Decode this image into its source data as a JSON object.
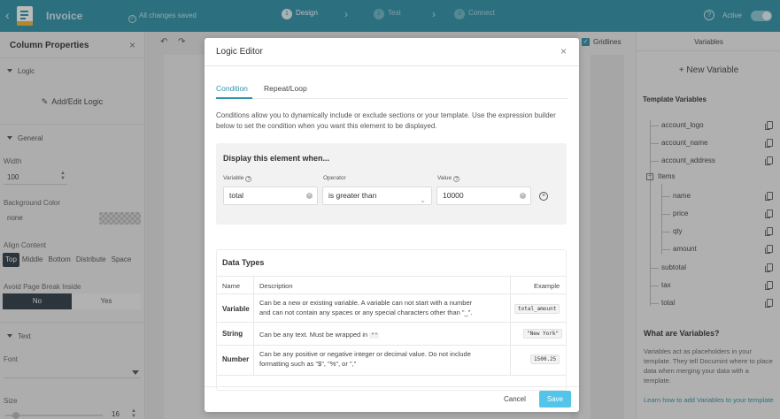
{
  "topbar": {
    "back": "‹",
    "app_title": "Invoice",
    "saved_status": "All changes saved",
    "steps": [
      {
        "num": "1",
        "label": "Design"
      },
      {
        "num": "2",
        "label": "Test"
      },
      {
        "num": "3",
        "label": "Connect"
      }
    ],
    "help": "?",
    "active_label": "Active"
  },
  "left_panel": {
    "title": "Column Properties",
    "close": "×",
    "logic_section": "Logic",
    "add_edit_logic": "Add/Edit Logic",
    "general_section": "General",
    "width_label": "Width",
    "width_value": "100",
    "bg_color_label": "Background Color",
    "bg_color_value": "none",
    "align_label": "Align Content",
    "align_options": [
      "Top",
      "Middle",
      "Bottom",
      "Distribute",
      "Space"
    ],
    "avoid_break_label": "Avoid Page Break Inside",
    "no_label": "No",
    "yes_label": "Yes",
    "text_section": "Text",
    "font_label": "Font",
    "size_label": "Size",
    "size_value": "16"
  },
  "canvas": {
    "undo": "↶",
    "redo": "↷",
    "gridlines_label": "Gridlines"
  },
  "variables_panel": {
    "title": "Variables",
    "new_variable": "+ New Variable",
    "template_variables_heading": "Template Variables",
    "variables": [
      "account_logo",
      "account_name",
      "account_address"
    ],
    "items_label": "Items",
    "item_children": [
      "name",
      "price",
      "qty",
      "amount"
    ],
    "after_items": [
      "subtotal",
      "tax",
      "total"
    ],
    "what_heading": "What are Variables?",
    "what_text": "Variables act as placeholders in your template. They tell Documint where to place data when merging your data with a template.",
    "learn_link": "Learn how to add Variables to your template"
  },
  "modal": {
    "title": "Logic Editor",
    "close": "×",
    "tabs": [
      "Condition",
      "Repeat/Loop"
    ],
    "description": "Conditions allow you to dynamically include or exclude sections or your template. Use the expression builder below to set the condition when you want this element to be displayed.",
    "condition": {
      "heading": "Display this element when...",
      "variable_label": "Variable",
      "operator_label": "Operator",
      "value_label": "Value",
      "variable_value": "total",
      "operator_value": "is greater than",
      "value_value": "10000"
    },
    "data_types": {
      "heading": "Data Types",
      "columns": [
        "Name",
        "Description",
        "Example"
      ],
      "rows": [
        {
          "name": "Variable",
          "desc_1": "Can be a new or existing variable. A variable can not start with a number",
          "desc_2": "and can not contain any spaces or any special characters other than \"_\".",
          "example": "total_amount"
        },
        {
          "name": "String",
          "desc_1": "Can be any text. Must be wrapped in",
          "desc_code": "\"\"",
          "example": "\"New York\""
        },
        {
          "name": "Number",
          "desc_1": "Can be any positive or negative integer or decimal value. Do not include",
          "desc_2": "formatting such as \"$\", \"%\", or \",\"",
          "example": "1500.25"
        }
      ]
    },
    "cancel": "Cancel",
    "save": "Save"
  }
}
